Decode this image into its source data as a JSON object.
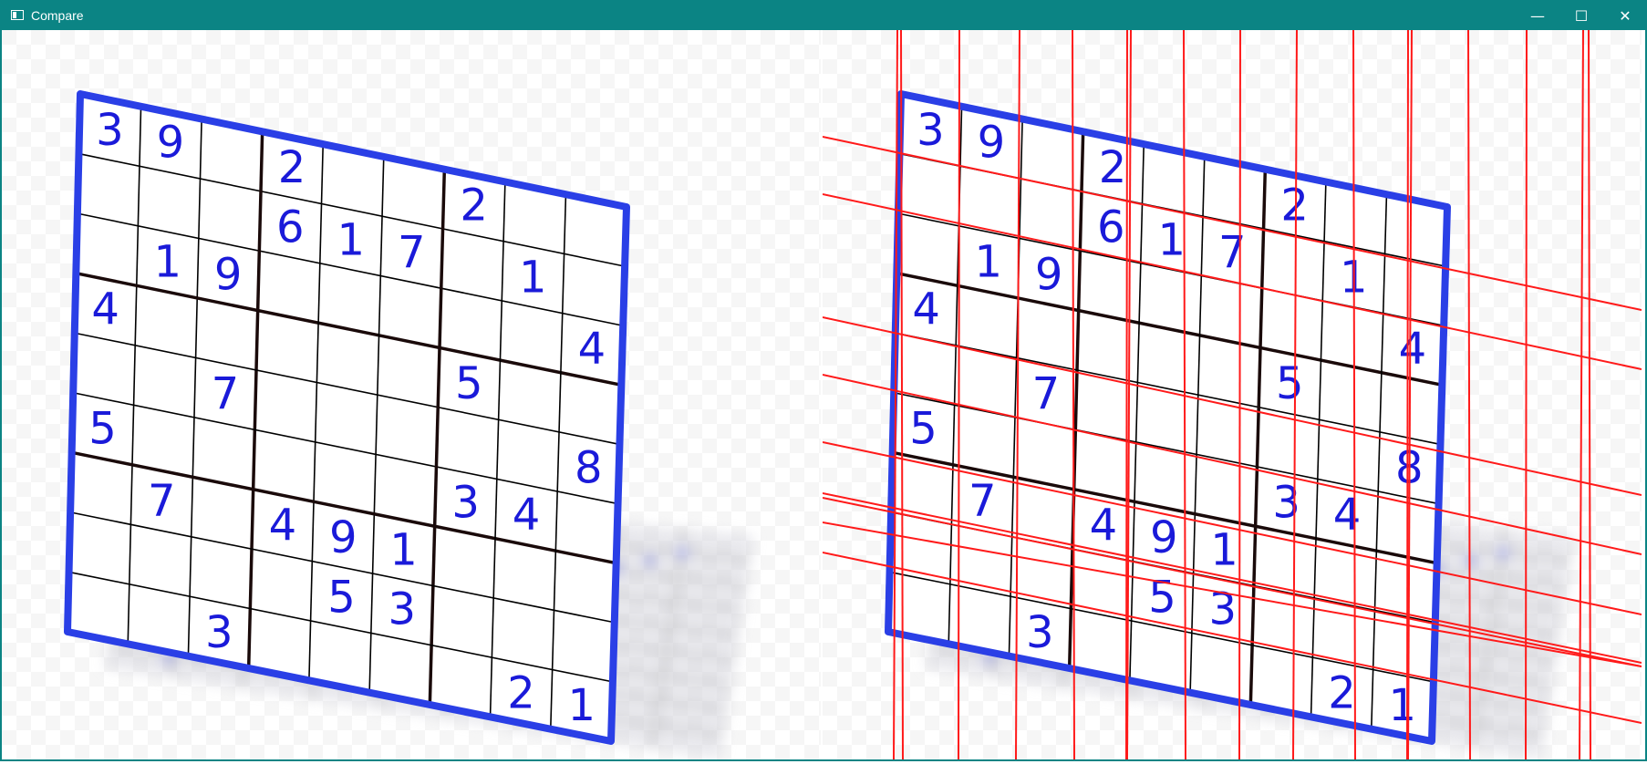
{
  "window": {
    "title": "Compare",
    "controls": {
      "minimize": "—",
      "maximize": "☐",
      "close": "✕"
    }
  },
  "sudoku": [
    [
      3,
      9,
      0,
      2,
      0,
      0,
      2,
      0,
      0
    ],
    [
      0,
      0,
      0,
      6,
      1,
      7,
      0,
      1,
      0
    ],
    [
      0,
      1,
      9,
      0,
      0,
      0,
      0,
      0,
      4
    ],
    [
      4,
      0,
      0,
      0,
      0,
      0,
      5,
      0,
      0
    ],
    [
      0,
      0,
      7,
      0,
      0,
      0,
      0,
      0,
      8
    ],
    [
      5,
      0,
      0,
      0,
      0,
      0,
      3,
      4,
      0
    ],
    [
      0,
      7,
      0,
      4,
      9,
      1,
      0,
      0,
      0
    ],
    [
      0,
      0,
      0,
      0,
      5,
      3,
      0,
      0,
      0
    ],
    [
      0,
      0,
      3,
      0,
      0,
      0,
      0,
      2,
      1
    ]
  ],
  "colors": {
    "titlebar": "#0b8484",
    "frame": "#2a3fe6",
    "digit": "#1a1ad9",
    "grid": "#000000",
    "detected_lines": "#ff1a1a"
  }
}
